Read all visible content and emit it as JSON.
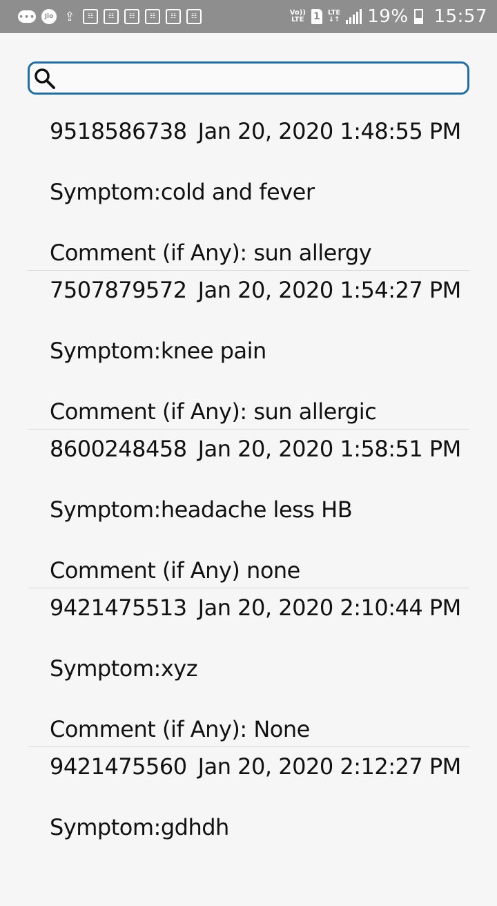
{
  "status_bar": {
    "menu_dots": "•••",
    "carrier_badge": "Jio",
    "upload_glyph": "⇪",
    "notification_glyph": "☷",
    "volte_top": "Vo))",
    "volte_bottom": "LTE",
    "sim_slot": "1",
    "lte_top": "LTE",
    "lte_bottom": "↓↑",
    "battery_percent": "19%",
    "time": "15:57"
  },
  "search": {
    "placeholder": "",
    "value": ""
  },
  "records": [
    {
      "phone": "9518586738",
      "timestamp": "Jan 20, 2020 1:48:55 PM",
      "symptom": "Symptom:cold and fever",
      "comment": "Comment (if Any): sun allergy"
    },
    {
      "phone": "7507879572",
      "timestamp": "Jan 20, 2020 1:54:27 PM",
      "symptom": "Symptom:knee pain",
      "comment": "Comment (if Any): sun allergic"
    },
    {
      "phone": "8600248458",
      "timestamp": "Jan 20, 2020 1:58:51 PM",
      "symptom": "Symptom:headache less HB",
      "comment": "Comment (if Any) none"
    },
    {
      "phone": "9421475513",
      "timestamp": "Jan 20, 2020 2:10:44 PM",
      "symptom": "Symptom:xyz",
      "comment": "Comment (if Any): None"
    },
    {
      "phone": "9421475560",
      "timestamp": "Jan 20, 2020 2:12:27 PM",
      "symptom": "Symptom:gdhdh",
      "comment": ""
    }
  ]
}
